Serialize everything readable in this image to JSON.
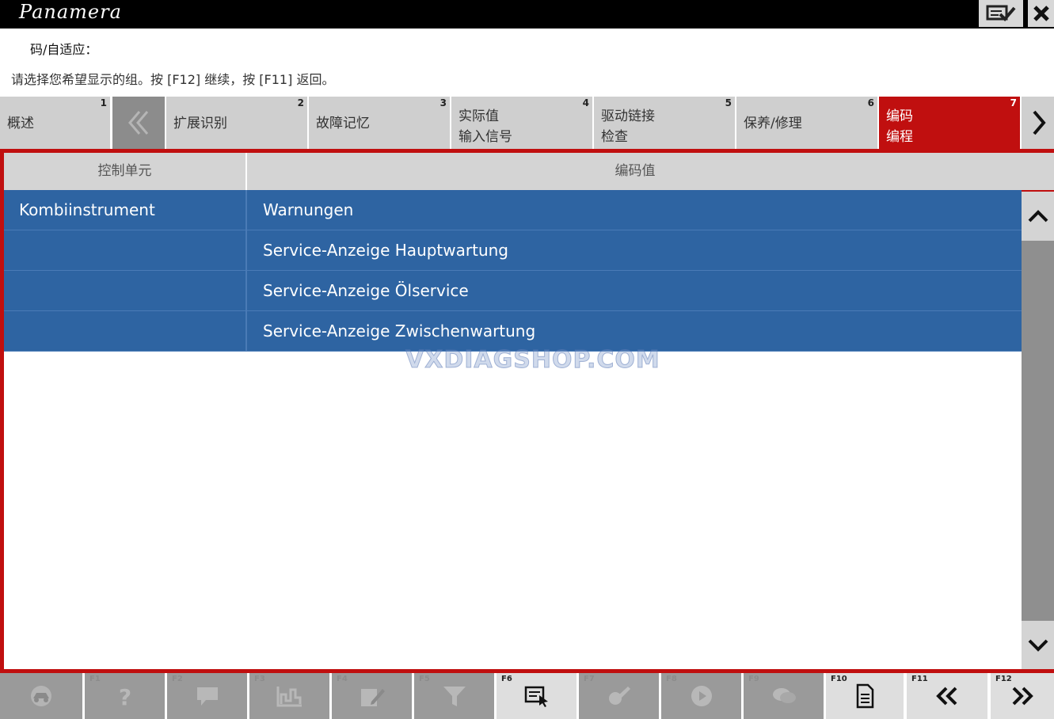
{
  "window": {
    "brand": "Panamera"
  },
  "header": {
    "title": "码/自适应：",
    "instruction": "请选择您希望显示的组。按 [F12] 继续，按 [F11] 返回。"
  },
  "tabs": [
    {
      "label": "概述",
      "num": "1"
    },
    {
      "label": "扩展识别",
      "num": "2"
    },
    {
      "label": "故障记忆",
      "num": "3"
    },
    {
      "label": "实际值\n输入信号",
      "num": "4"
    },
    {
      "label": "驱动链接\n检查",
      "num": "5"
    },
    {
      "label": "保养/修理",
      "num": "6"
    },
    {
      "label": "编码\n编程",
      "num": "7",
      "active": true
    }
  ],
  "table": {
    "headers": [
      "控制单元",
      "编码值"
    ],
    "rows": [
      [
        "Kombiinstrument",
        "Warnungen"
      ],
      [
        "",
        "Service-Anzeige Hauptwartung"
      ],
      [
        "",
        "Service-Anzeige Ölservice"
      ],
      [
        "",
        "Service-Anzeige Zwischenwartung"
      ]
    ]
  },
  "watermark": "VXDIAGSHOP.COM",
  "function_keys": [
    {
      "key": "",
      "icon": "car-icon"
    },
    {
      "key": "F1",
      "icon": "help-icon"
    },
    {
      "key": "F2",
      "icon": "comment-icon"
    },
    {
      "key": "F3",
      "icon": "chart-icon"
    },
    {
      "key": "F4",
      "icon": "edit-icon"
    },
    {
      "key": "F5",
      "icon": "filter-icon"
    },
    {
      "key": "F6",
      "icon": "select-list-icon",
      "enabled": true
    },
    {
      "key": "F7",
      "icon": "tools-icon"
    },
    {
      "key": "F8",
      "icon": "play-icon"
    },
    {
      "key": "F9",
      "icon": "chat-icon"
    },
    {
      "key": "F10",
      "icon": "document-icon",
      "enabled": true
    },
    {
      "key": "F11",
      "icon": "double-chevron-left-icon",
      "enabled": true
    },
    {
      "key": "F12",
      "icon": "double-chevron-right-icon",
      "enabled": true
    }
  ],
  "colors": {
    "accent_red": "#c00f0f",
    "row_blue": "#2e64a2",
    "tab_gray": "#cfcfcf"
  }
}
